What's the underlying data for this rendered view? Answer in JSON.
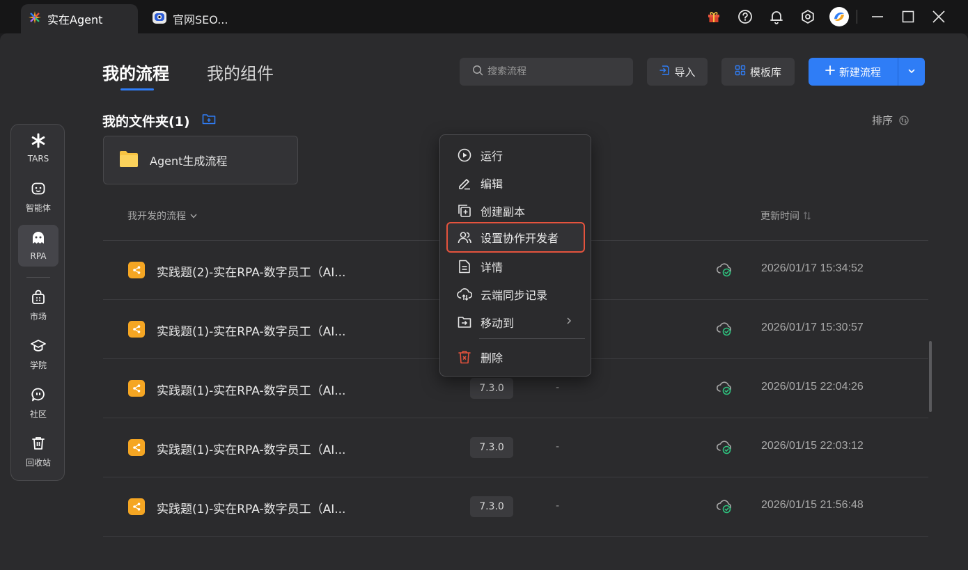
{
  "titlebar": {
    "tabs": [
      {
        "label": "实在Agent",
        "icon": "sparkle-logo-icon",
        "active": true
      },
      {
        "label": "官网SEO...",
        "icon": "robot-face-icon",
        "active": false
      }
    ],
    "icons": [
      "gift-icon",
      "help-icon",
      "bell-icon",
      "settings-icon",
      "avatar",
      "minimize-icon",
      "maximize-icon",
      "close-icon"
    ]
  },
  "sidebar": {
    "items": [
      {
        "label": "TARS",
        "icon": "asterisk-icon"
      },
      {
        "label": "智能体",
        "icon": "agent-face-icon"
      },
      {
        "label": "RPA",
        "icon": "ghost-icon",
        "active": true
      },
      {
        "label": "市场",
        "icon": "bag-icon"
      },
      {
        "label": "学院",
        "icon": "graduation-cap-icon"
      },
      {
        "label": "社区",
        "icon": "chat-bubble-icon"
      },
      {
        "label": "回收站",
        "icon": "trash-icon"
      }
    ]
  },
  "header": {
    "tabs": [
      "我的流程",
      "我的组件"
    ],
    "search_placeholder": "搜索流程",
    "import_label": "导入",
    "templates_label": "模板库",
    "new_label": "新建流程"
  },
  "folders": {
    "heading": "我的文件夹(1)",
    "sort_label": "排序",
    "items": [
      {
        "name": "Agent生成流程"
      }
    ]
  },
  "table": {
    "filter_label": "我开发的流程",
    "updated_header": "更新时间",
    "rows": [
      {
        "name": "实践题(2)-实在RPA-数字员工（AI...",
        "version": "",
        "collaborators": "",
        "time": "2026/01/17 15:34:52"
      },
      {
        "name": "实践题(1)-实在RPA-数字员工（AI...",
        "version": "",
        "collaborators": "",
        "time": "2026/01/17 15:30:57"
      },
      {
        "name": "实践题(1)-实在RPA-数字员工（AI...",
        "version": "7.3.0",
        "collaborators": "-",
        "time": "2026/01/15 22:04:26"
      },
      {
        "name": "实践题(1)-实在RPA-数字员工（AI...",
        "version": "7.3.0",
        "collaborators": "-",
        "time": "2026/01/15 22:03:12"
      },
      {
        "name": "实践题(1)-实在RPA-数字员工（AI...",
        "version": "7.3.0",
        "collaborators": "-",
        "time": "2026/01/15 21:56:48"
      }
    ]
  },
  "context_menu": {
    "items": [
      {
        "label": "运行",
        "icon": "play-icon"
      },
      {
        "label": "编辑",
        "icon": "pencil-icon"
      },
      {
        "label": "创建副本",
        "icon": "copy-icon"
      },
      {
        "label": "设置协作开发者",
        "icon": "users-icon",
        "highlighted": true
      },
      {
        "label": "详情",
        "icon": "document-icon"
      },
      {
        "label": "云端同步记录",
        "icon": "cloud-sync-icon"
      },
      {
        "label": "移动到",
        "icon": "folder-move-icon",
        "submenu": true
      },
      {
        "label": "删除",
        "icon": "delete-icon",
        "danger": true
      }
    ]
  },
  "colors": {
    "accent": "#2f7df6",
    "highlight_border": "#e5533d",
    "danger": "#e5533d",
    "flow_icon": "#f5a623",
    "folder": "#f7c342",
    "sync_ok": "#2ec27e"
  }
}
